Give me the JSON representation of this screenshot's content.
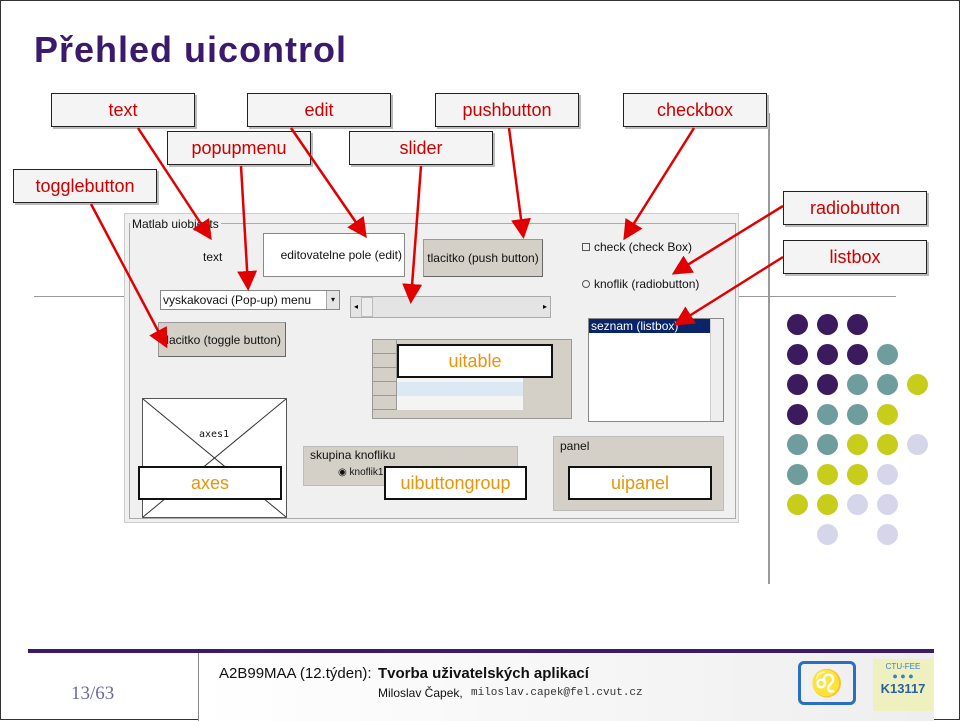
{
  "title": "Přehled uicontrol",
  "labels": {
    "text": "text",
    "edit": "edit",
    "pushbutton": "pushbutton",
    "checkbox": "checkbox",
    "popupmenu": "popupmenu",
    "slider": "slider",
    "togglebutton": "togglebutton",
    "radiobutton": "radiobutton",
    "listbox": "listbox",
    "uitable": "uitable",
    "axes": "axes",
    "uibuttongroup": "uibuttongroup",
    "uipanel": "uipanel"
  },
  "figure": {
    "frame_title": "Matlab uiobjects",
    "text": "text",
    "edit": "editovatelne pole (edit)",
    "pushbutton": "tlacitko (push button)",
    "checkbox": "check (check Box)",
    "radio": "knoflik (radiobutton)",
    "popup": "vyskakovaci (Pop-up) menu",
    "toggle": "tlacitko (toggle button)",
    "listbox_item": "seznam (listbox)",
    "axes": "axes1",
    "buttongroup_title": "skupina knofliku",
    "buttongroup_radio": "knoflik1",
    "panel_title": "panel"
  },
  "footer": {
    "page": "13/63",
    "course": "A2B99MAA (12.týden):",
    "topic": "Tvorba uživatelských aplikací",
    "author": "Miloslav Čapek,",
    "email": "miloslav.capek@fel.cvut.cz",
    "logo1": "ČVUT lion",
    "logo2": "CTU-FEE K13117"
  },
  "colors": {
    "title": "#3b1a6e",
    "arrow": "#e00000",
    "label_text": "#cc0000",
    "overlay_text": "#e8950c",
    "dot_purple": "#3b1a5e",
    "dot_teal": "#6f9c9c",
    "dot_yellow": "#c8cc1a",
    "dot_lavender": "#d6d6ea"
  }
}
